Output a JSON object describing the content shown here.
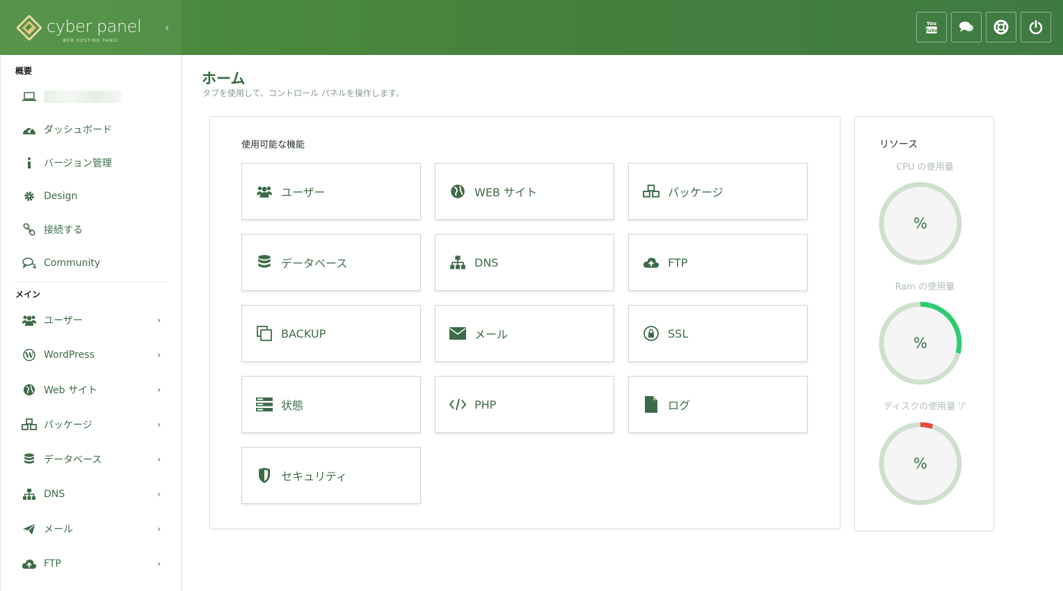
{
  "header": {
    "brand_name": "cyber panel",
    "brand_sub": "WEB HOSTING PANEL",
    "collapse_glyph": "‹",
    "buttons": [
      {
        "name": "youtube-icon"
      },
      {
        "name": "chat-icon"
      },
      {
        "name": "support-icon"
      },
      {
        "name": "power-icon"
      }
    ]
  },
  "sidebar": {
    "section_overview": "概要",
    "section_main": "メイン",
    "overview_items": [
      {
        "icon": "laptop-icon",
        "label": ""
      },
      {
        "icon": "dashboard-icon",
        "label": "ダッシュボード"
      },
      {
        "icon": "info-icon",
        "label": "バージョン管理"
      },
      {
        "icon": "gear-icon",
        "label": "Design"
      },
      {
        "icon": "link-icon",
        "label": "接続する"
      },
      {
        "icon": "comments-icon",
        "label": "Community"
      }
    ],
    "main_items": [
      {
        "icon": "users-icon",
        "label": "ユーザー"
      },
      {
        "icon": "wordpress-icon",
        "label": "WordPress"
      },
      {
        "icon": "globe-icon",
        "label": "Web サイト"
      },
      {
        "icon": "cubes-icon",
        "label": "パッケージ"
      },
      {
        "icon": "database-icon",
        "label": "データベース"
      },
      {
        "icon": "sitemap-icon",
        "label": "DNS"
      },
      {
        "icon": "paper-plane-icon",
        "label": "メール"
      },
      {
        "icon": "cloud-upload-icon",
        "label": "FTP"
      }
    ],
    "chevron": "›"
  },
  "page": {
    "title": "ホーム",
    "subtitle": "タブを使用して、コントロール パネルを操作します。"
  },
  "features": {
    "title": "使用可能な機能",
    "tiles": [
      {
        "icon": "users-icon",
        "label": "ユーザー"
      },
      {
        "icon": "globe-icon",
        "label": "WEB サイト"
      },
      {
        "icon": "cubes-icon",
        "label": "パッケージ"
      },
      {
        "icon": "database-icon",
        "label": "データベース"
      },
      {
        "icon": "sitemap-icon",
        "label": "DNS"
      },
      {
        "icon": "cloud-upload-icon",
        "label": "FTP"
      },
      {
        "icon": "copy-icon",
        "label": "BACKUP"
      },
      {
        "icon": "envelope-icon",
        "label": "メール"
      },
      {
        "icon": "lock-icon",
        "label": "SSL"
      },
      {
        "icon": "server-icon",
        "label": "状態"
      },
      {
        "icon": "code-icon",
        "label": "PHP"
      },
      {
        "icon": "file-icon",
        "label": "ログ"
      },
      {
        "icon": "shield-icon",
        "label": "セキュリティ"
      }
    ]
  },
  "resources": {
    "title": "リソース",
    "gauges": [
      {
        "label": "CPU の使用量",
        "pct_text": "%",
        "fraction": 0.0,
        "color": "#2ecc71"
      },
      {
        "label": "Ram の使用量",
        "pct_text": "%",
        "fraction": 0.29,
        "color": "#2ecc71"
      },
      {
        "label": "ディスクの使用量 '/'",
        "pct_text": "%",
        "fraction": 0.05,
        "color": "#e74c3c"
      }
    ]
  },
  "colors": {
    "accent": "#3e6b47",
    "header": "#4a8740",
    "gauge_track": "#cfe0cd"
  }
}
